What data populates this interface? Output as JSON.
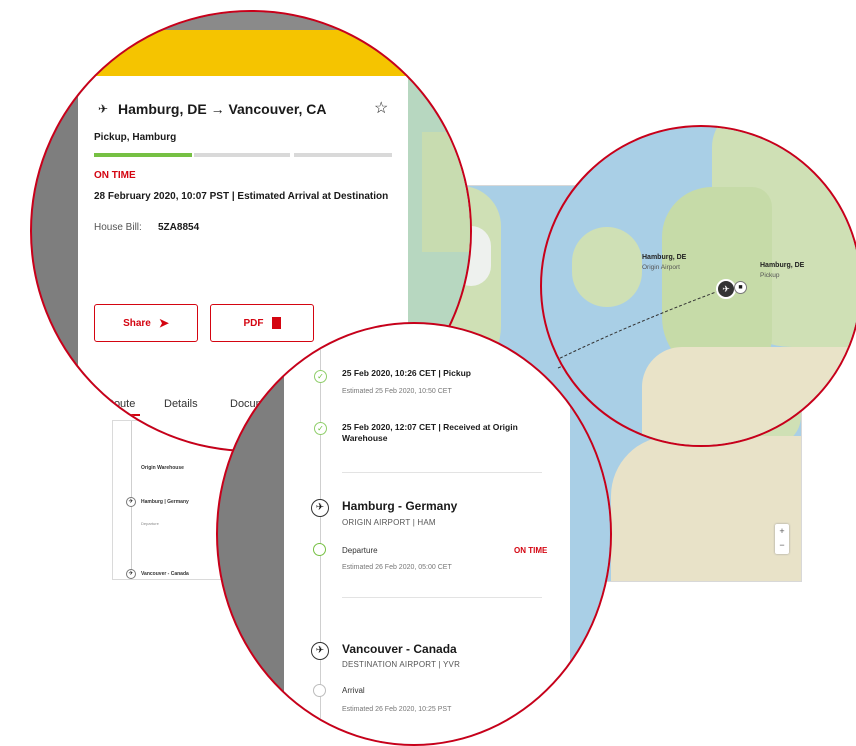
{
  "shipment": {
    "route_title": "Hamburg, DE → Vancouver, CA",
    "status_location": "Pickup, Hamburg",
    "progress_fraction": 0.33,
    "status": "ON TIME",
    "eta_line": "28 February 2020, 10:07 PST | Estimated Arrival at Destination",
    "house_bill_label": "House Bill:",
    "house_bill_value": "5ZA8854",
    "share_label": "Share",
    "pdf_label": "PDF"
  },
  "tabs": [
    "Route",
    "Details",
    "Document"
  ],
  "map": {
    "origin_name": "Hamburg, DE",
    "origin_sub": "Origin Airport",
    "pickup_name": "Hamburg, DE",
    "pickup_sub": "Pickup",
    "zoom_in": "+",
    "zoom_out": "−"
  },
  "timeline": {
    "events": [
      {
        "title": "25 Feb 2020, 10:26 CET | Pickup",
        "sub": "Estimated 25 Feb 2020, 10:50 CET"
      },
      {
        "title": "25 Feb 2020, 12:07 CET | Received at Origin Warehouse",
        "sub": ""
      }
    ],
    "origin": {
      "place": "Hamburg - Germany",
      "sub": "ORIGIN AIRPORT | HAM",
      "step": "Departure",
      "step_status": "ON TIME",
      "step_sub": "Estimated 26 Feb 2020, 05:00 CET"
    },
    "destination": {
      "place": "Vancouver - Canada",
      "sub": "DESTINATION AIRPORT | YVR",
      "step": "Arrival",
      "step_sub": "Estimated 26 Feb 2020, 10:25 PST"
    }
  },
  "mini_card": {
    "items": [
      "Origin Warehouse",
      "Hamburg | Germany",
      "Departure",
      "Vancouver - Canada"
    ]
  },
  "colors": {
    "accent_red": "#d40511",
    "brand_yellow": "#f5c400",
    "success_green": "#76c043"
  }
}
